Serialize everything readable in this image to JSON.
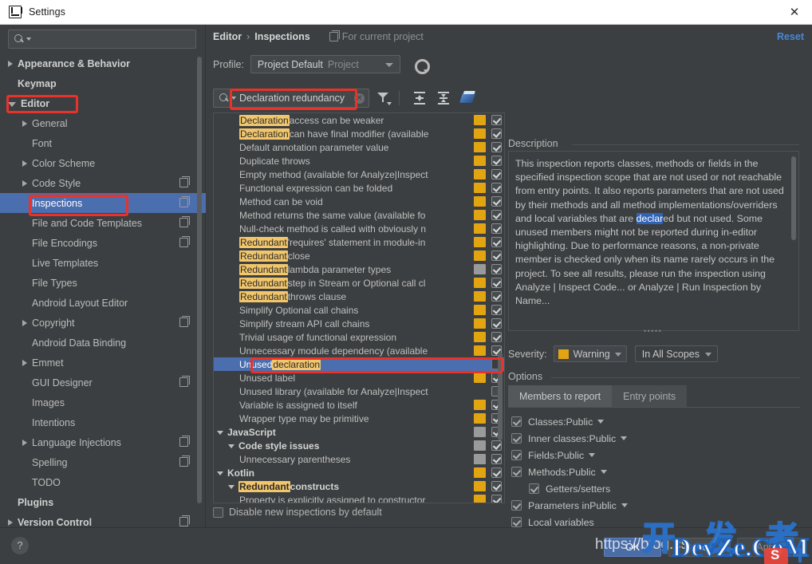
{
  "window": {
    "title": "Settings",
    "close_label": "✕",
    "app_icon": "intellij-idea-icon"
  },
  "sidebar": {
    "search": {
      "value": "",
      "placeholder": ""
    },
    "items": [
      {
        "label": "Appearance & Behavior",
        "level": 0,
        "arrow": "right",
        "bold": true,
        "copy": false,
        "selected": false
      },
      {
        "label": "Keymap",
        "level": 0,
        "arrow": "none",
        "bold": true,
        "copy": false,
        "selected": false
      },
      {
        "label": "Editor",
        "level": 0,
        "arrow": "down",
        "bold": true,
        "copy": false,
        "selected": false
      },
      {
        "label": "General",
        "level": 1,
        "arrow": "right",
        "bold": false,
        "copy": false,
        "selected": false
      },
      {
        "label": "Font",
        "level": 1,
        "arrow": "none",
        "bold": false,
        "copy": false,
        "selected": false
      },
      {
        "label": "Color Scheme",
        "level": 1,
        "arrow": "right",
        "bold": false,
        "copy": false,
        "selected": false
      },
      {
        "label": "Code Style",
        "level": 1,
        "arrow": "right",
        "bold": false,
        "copy": true,
        "selected": false
      },
      {
        "label": "Inspections",
        "level": 1,
        "arrow": "none",
        "bold": false,
        "copy": true,
        "selected": true
      },
      {
        "label": "File and Code Templates",
        "level": 1,
        "arrow": "none",
        "bold": false,
        "copy": true,
        "selected": false
      },
      {
        "label": "File Encodings",
        "level": 1,
        "arrow": "none",
        "bold": false,
        "copy": true,
        "selected": false
      },
      {
        "label": "Live Templates",
        "level": 1,
        "arrow": "none",
        "bold": false,
        "copy": false,
        "selected": false
      },
      {
        "label": "File Types",
        "level": 1,
        "arrow": "none",
        "bold": false,
        "copy": false,
        "selected": false
      },
      {
        "label": "Android Layout Editor",
        "level": 1,
        "arrow": "none",
        "bold": false,
        "copy": false,
        "selected": false
      },
      {
        "label": "Copyright",
        "level": 1,
        "arrow": "right",
        "bold": false,
        "copy": true,
        "selected": false
      },
      {
        "label": "Android Data Binding",
        "level": 1,
        "arrow": "none",
        "bold": false,
        "copy": false,
        "selected": false
      },
      {
        "label": "Emmet",
        "level": 1,
        "arrow": "right",
        "bold": false,
        "copy": false,
        "selected": false
      },
      {
        "label": "GUI Designer",
        "level": 1,
        "arrow": "none",
        "bold": false,
        "copy": true,
        "selected": false
      },
      {
        "label": "Images",
        "level": 1,
        "arrow": "none",
        "bold": false,
        "copy": false,
        "selected": false
      },
      {
        "label": "Intentions",
        "level": 1,
        "arrow": "none",
        "bold": false,
        "copy": false,
        "selected": false
      },
      {
        "label": "Language Injections",
        "level": 1,
        "arrow": "right",
        "bold": false,
        "copy": true,
        "selected": false
      },
      {
        "label": "Spelling",
        "level": 1,
        "arrow": "none",
        "bold": false,
        "copy": true,
        "selected": false
      },
      {
        "label": "TODO",
        "level": 1,
        "arrow": "none",
        "bold": false,
        "copy": false,
        "selected": false
      },
      {
        "label": "Plugins",
        "level": 0,
        "arrow": "none",
        "bold": true,
        "copy": false,
        "selected": false
      },
      {
        "label": "Version Control",
        "level": 0,
        "arrow": "right",
        "bold": true,
        "copy": true,
        "selected": false
      }
    ]
  },
  "header": {
    "breadcrumb_parent": "Editor",
    "breadcrumb_sep": "›",
    "breadcrumb_current": "Inspections",
    "scope_hint": "For current project",
    "reset_label": "Reset"
  },
  "profile": {
    "label": "Profile:",
    "value": "Project Default",
    "suffix": "Project"
  },
  "toolbar": {
    "filter_value": "Declaration redundancy",
    "filter_placeholder": "",
    "clear_glyph": "✕",
    "buttons": [
      {
        "name": "filter-icon"
      },
      {
        "name": "expand-all-icon"
      },
      {
        "name": "collapse-all-icon"
      },
      {
        "name": "reset-to-defaults-icon"
      }
    ]
  },
  "inspections": {
    "rows": [
      {
        "label": "Declaration",
        "rest": " access can be weaker",
        "level": 2,
        "highlight": true,
        "group": false,
        "arrow": "none",
        "severity": "warn",
        "checked": true,
        "selected": false
      },
      {
        "label": "Declaration",
        "rest": " can have final modifier (available",
        "level": 2,
        "highlight": true,
        "group": false,
        "arrow": "none",
        "severity": "warn",
        "checked": true,
        "selected": false
      },
      {
        "label": "",
        "rest": "Default annotation parameter value",
        "level": 2,
        "highlight": false,
        "group": false,
        "arrow": "none",
        "severity": "warn",
        "checked": true,
        "selected": false
      },
      {
        "label": "",
        "rest": "Duplicate throws",
        "level": 2,
        "highlight": false,
        "group": false,
        "arrow": "none",
        "severity": "warn",
        "checked": true,
        "selected": false
      },
      {
        "label": "",
        "rest": "Empty method (available for Analyze|Inspect",
        "level": 2,
        "highlight": false,
        "group": false,
        "arrow": "none",
        "severity": "warn",
        "checked": true,
        "selected": false
      },
      {
        "label": "",
        "rest": "Functional expression can be folded",
        "level": 2,
        "highlight": false,
        "group": false,
        "arrow": "none",
        "severity": "warn",
        "checked": true,
        "selected": false
      },
      {
        "label": "",
        "rest": "Method can be void",
        "level": 2,
        "highlight": false,
        "group": false,
        "arrow": "none",
        "severity": "warn",
        "checked": true,
        "selected": false
      },
      {
        "label": "",
        "rest": "Method returns the same value (available fo",
        "level": 2,
        "highlight": false,
        "group": false,
        "arrow": "none",
        "severity": "warn",
        "checked": true,
        "selected": false
      },
      {
        "label": "",
        "rest": "Null-check method is called with obviously n",
        "level": 2,
        "highlight": false,
        "group": false,
        "arrow": "none",
        "severity": "warn",
        "checked": true,
        "selected": false
      },
      {
        "label": "Redundant",
        "rest": " 'requires' statement in module-in",
        "level": 2,
        "highlight": true,
        "group": false,
        "arrow": "none",
        "severity": "warn",
        "checked": true,
        "selected": false
      },
      {
        "label": "Redundant",
        "rest": " close",
        "level": 2,
        "highlight": true,
        "group": false,
        "arrow": "none",
        "severity": "warn",
        "checked": true,
        "selected": false
      },
      {
        "label": "Redundant",
        "rest": " lambda parameter types",
        "level": 2,
        "highlight": true,
        "group": false,
        "arrow": "none",
        "severity": "none",
        "checked": true,
        "selected": false
      },
      {
        "label": "Redundant",
        "rest": " step in Stream or Optional call cl",
        "level": 2,
        "highlight": true,
        "group": false,
        "arrow": "none",
        "severity": "warn",
        "checked": true,
        "selected": false
      },
      {
        "label": "Redundant",
        "rest": " throws clause",
        "level": 2,
        "highlight": true,
        "group": false,
        "arrow": "none",
        "severity": "warn",
        "checked": true,
        "selected": false
      },
      {
        "label": "",
        "rest": "Simplify Optional call chains",
        "level": 2,
        "highlight": false,
        "group": false,
        "arrow": "none",
        "severity": "warn",
        "checked": true,
        "selected": false
      },
      {
        "label": "",
        "rest": "Simplify stream API call chains",
        "level": 2,
        "highlight": false,
        "group": false,
        "arrow": "none",
        "severity": "warn",
        "checked": true,
        "selected": false
      },
      {
        "label": "",
        "rest": "Trivial usage of functional expression",
        "level": 2,
        "highlight": false,
        "group": false,
        "arrow": "none",
        "severity": "warn",
        "checked": true,
        "selected": false
      },
      {
        "label": "",
        "rest": "Unnecessary module dependency (available",
        "level": 2,
        "highlight": false,
        "group": false,
        "arrow": "none",
        "severity": "warn",
        "checked": true,
        "selected": false
      },
      {
        "label": "Unused ",
        "rest": "declaration",
        "level": 2,
        "highlight": "tail",
        "group": false,
        "arrow": "none",
        "severity": "hidden",
        "checked": "dark",
        "selected": true
      },
      {
        "label": "",
        "rest": "Unused label",
        "level": 2,
        "highlight": false,
        "group": false,
        "arrow": "none",
        "severity": "warn",
        "checked": true,
        "selected": false
      },
      {
        "label": "",
        "rest": "Unused library (available for Analyze|Inspect",
        "level": 2,
        "highlight": false,
        "group": false,
        "arrow": "none",
        "severity": "hidden",
        "checked": false,
        "selected": false
      },
      {
        "label": "",
        "rest": "Variable is assigned to itself",
        "level": 2,
        "highlight": false,
        "group": false,
        "arrow": "none",
        "severity": "warn",
        "checked": true,
        "selected": false
      },
      {
        "label": "",
        "rest": "Wrapper type may be primitive",
        "level": 2,
        "highlight": false,
        "group": false,
        "arrow": "none",
        "severity": "warn",
        "checked": true,
        "selected": false
      },
      {
        "label": "",
        "rest": "JavaScript",
        "level": 0,
        "highlight": false,
        "group": true,
        "arrow": "down",
        "severity": "none",
        "checked": true,
        "selected": false
      },
      {
        "label": "",
        "rest": "Code style issues",
        "level": 1,
        "highlight": false,
        "group": true,
        "arrow": "down",
        "severity": "none",
        "checked": true,
        "selected": false
      },
      {
        "label": "",
        "rest": "Unnecessary parentheses",
        "level": 2,
        "highlight": false,
        "group": false,
        "arrow": "none",
        "severity": "none",
        "checked": true,
        "selected": false
      },
      {
        "label": "",
        "rest": "Kotlin",
        "level": 0,
        "highlight": false,
        "group": true,
        "arrow": "down",
        "severity": "warn",
        "checked": true,
        "selected": false
      },
      {
        "label": "Redundant",
        "rest": " constructs",
        "level": 1,
        "highlight": true,
        "group": true,
        "arrow": "down",
        "severity": "warn",
        "checked": true,
        "selected": false
      },
      {
        "label": "",
        "rest": "Property is explicitly assigned to constructor",
        "level": 2,
        "highlight": false,
        "group": false,
        "arrow": "none",
        "severity": "warn",
        "checked": true,
        "selected": false
      }
    ],
    "disable_new_label": "Disable new inspections by default",
    "disable_new_checked": false
  },
  "description": {
    "title": "Description",
    "part1": "This inspection reports classes, methods or fields in the specified inspection scope that are not used or not reachable from entry points. It also reports parameters that are not used by their methods and all method implementations/overriders and local variables that are ",
    "selected_word": "declar",
    "part2": "ed but not used. Some unused members might not be reported during in-editor highlighting. Due to performance reasons, a non-private member is checked only when its name rarely occurs in the project. To see all results, please run the inspection using Analyze | Inspect Code... or Analyze | Run Inspection by Name..."
  },
  "severity": {
    "label": "Severity:",
    "value": "Warning",
    "color": "#e3a411",
    "scope_value": "In All Scopes"
  },
  "options": {
    "title": "Options",
    "tabs": [
      {
        "label": "Members to report",
        "active": true
      },
      {
        "label": "Entry points",
        "active": false
      }
    ],
    "items": [
      {
        "label": "Classes:Public",
        "checked": true,
        "dropdown": true,
        "indent": false
      },
      {
        "label": "Inner classes:Public",
        "checked": true,
        "dropdown": true,
        "indent": false
      },
      {
        "label": "Fields:Public",
        "checked": true,
        "dropdown": true,
        "indent": false
      },
      {
        "label": "Methods:Public",
        "checked": true,
        "dropdown": true,
        "indent": false
      },
      {
        "label": "Getters/setters",
        "checked": true,
        "dropdown": false,
        "indent": true
      },
      {
        "label": "Parameters inPublic",
        "checked": true,
        "dropdown": true,
        "indent": false
      },
      {
        "label": "Local variables",
        "checked": true,
        "dropdown": false,
        "indent": false
      }
    ]
  },
  "footer": {
    "help_label": "?",
    "ok_label": "OK",
    "cancel_label": "Cancel",
    "apply_label": "Apply"
  },
  "watermarks": {
    "chinese": "开 发 者",
    "site": "DevZe.CoM",
    "url": "https://blog.cs"
  }
}
